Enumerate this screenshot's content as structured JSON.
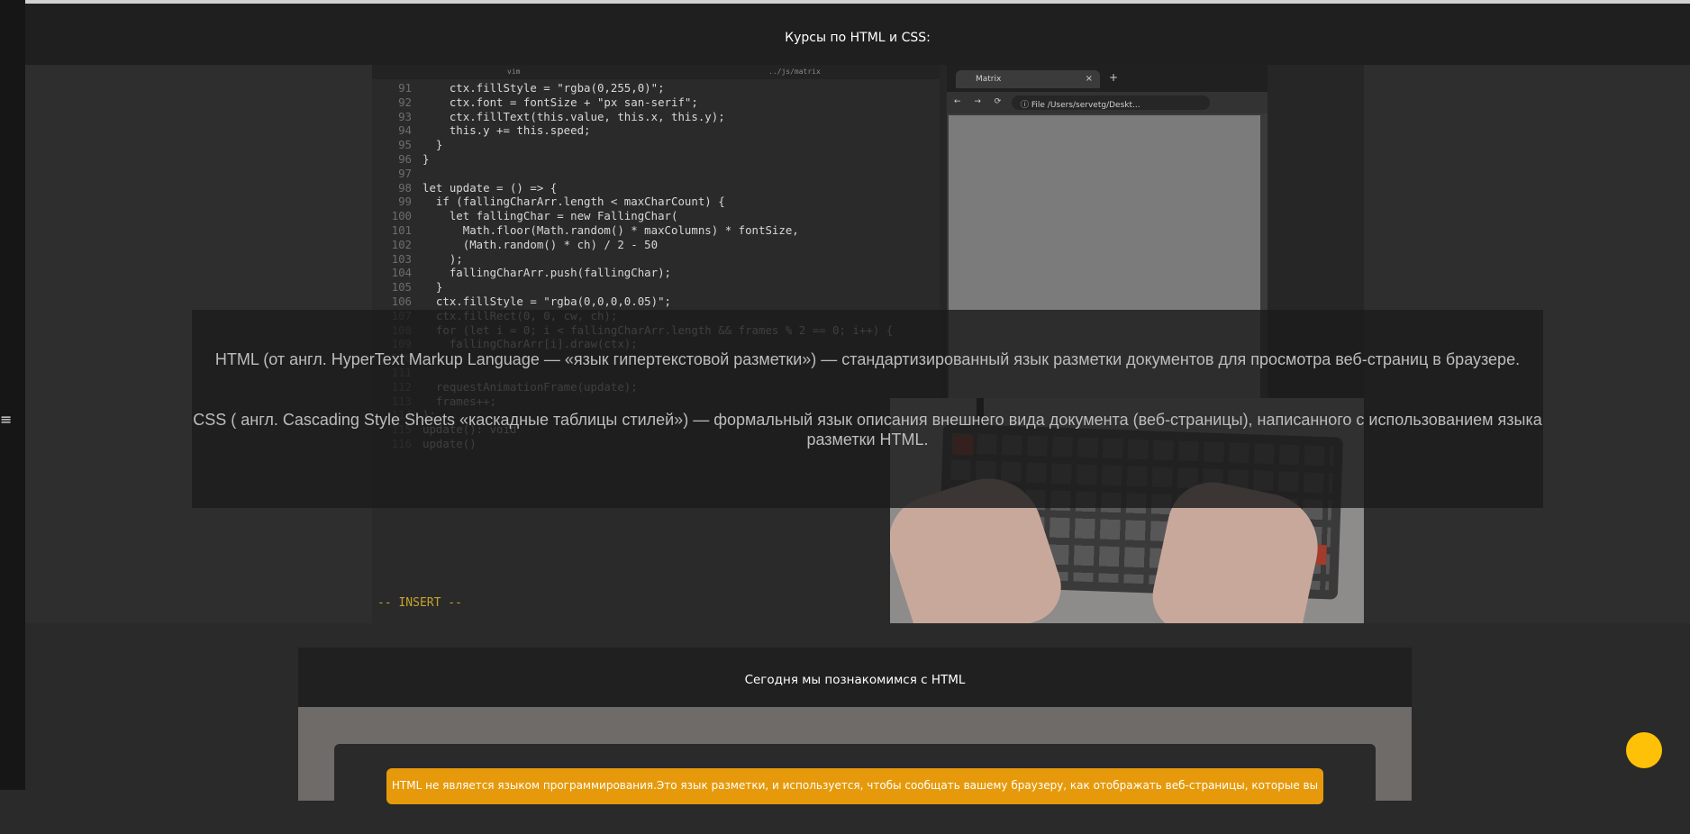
{
  "header": {
    "title": "Курсы по HTML и CSS:"
  },
  "nav": {
    "menu_glyph": "≡",
    "menu_icon": "hamburger-menu-icon"
  },
  "hero_overlay": {
    "paragraph_html": "HTML (от англ. HyperText Markup Language — «язык гипертекстовой разметки») — стандартизированный язык разметки документов для просмотра веб-страниц в браузере.",
    "paragraph_css": "CSS ( англ. Cascading Style Sheets «каскадные таблицы стилей») — формальный язык описания внешнего вида документа (веб-страницы), написанного с использованием языка разметки HTML."
  },
  "video": {
    "editor_tabs": [
      "vim",
      "../js/matrix"
    ],
    "code_lines": [
      {
        "n": "91",
        "text": "    ctx.fillStyle = \"rgba(0,255,0)\";"
      },
      {
        "n": "92",
        "text": "    ctx.font = fontSize + \"px san-serif\";"
      },
      {
        "n": "93",
        "text": "    ctx.fillText(this.value, this.x, this.y);"
      },
      {
        "n": "94",
        "text": "    this.y += this.speed;"
      },
      {
        "n": "95",
        "text": "  }"
      },
      {
        "n": "96",
        "text": "}"
      },
      {
        "n": "97",
        "text": ""
      },
      {
        "n": "98",
        "text": "let update = () => {"
      },
      {
        "n": "99",
        "text": "  if (fallingCharArr.length < maxCharCount) {"
      },
      {
        "n": "100",
        "text": "    let fallingChar = new FallingChar("
      },
      {
        "n": "101",
        "text": "      Math.floor(Math.random() * maxColumns) * fontSize,"
      },
      {
        "n": "102",
        "text": "      (Math.random() * ch) / 2 - 50"
      },
      {
        "n": "103",
        "text": "    );"
      },
      {
        "n": "104",
        "text": "    fallingCharArr.push(fallingChar);"
      },
      {
        "n": "105",
        "text": "  }"
      },
      {
        "n": "106",
        "text": "  ctx.fillStyle = \"rgba(0,0,0,0.05)\";"
      },
      {
        "n": "107",
        "text": "  ctx.fillRect(0, 0, cw, ch);"
      },
      {
        "n": "108",
        "text": "  for (let i = 0; i < fallingCharArr.length && frames % 2 == 0; i++) {"
      },
      {
        "n": "109",
        "text": "    fallingCharArr[i].draw(ctx);"
      },
      {
        "n": "110",
        "text": "  }"
      },
      {
        "n": "111",
        "text": ""
      },
      {
        "n": "112",
        "text": "  requestAnimationFrame(update);"
      },
      {
        "n": "113",
        "text": "  frames++;"
      },
      {
        "n": "114",
        "text": "};"
      },
      {
        "n": "115",
        "text": "update(): void"
      },
      {
        "n": "116",
        "text": "update()"
      }
    ],
    "editor_mode": "-- INSERT --",
    "browser_tab_title": "Matrix",
    "browser_tab_close": "×",
    "browser_new_tab": "+",
    "browser_nav": "← → ⟳",
    "browser_url": "ⓘ File  /Users/servetg/Deskt..."
  },
  "section": {
    "title": "Сегодня мы познакомимся с HTML",
    "notice": "HTML не является языком программирования.Это язык разметки, и используется, чтобы сообщать вашему браузеру, как отображать веб-страницы, которые вы"
  },
  "fab": {
    "icon": "chat-bubble-icon",
    "color": "#ffc107"
  }
}
